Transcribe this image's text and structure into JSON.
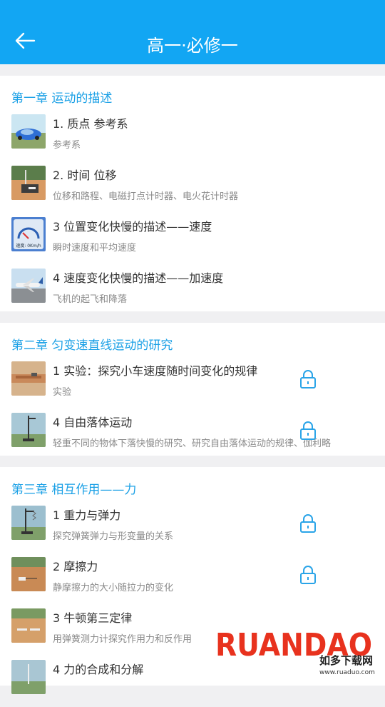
{
  "header": {
    "title": "高一·必修一"
  },
  "colors": {
    "accent": "#12a6f3",
    "chapter": "#1aa0e6"
  },
  "chapters": [
    {
      "title": "第一章 运动的描述",
      "lessons": [
        {
          "title": "1. 质点 参考系",
          "subtitle": "参考系",
          "locked": false,
          "thumb": "race-car-icon"
        },
        {
          "title": "2. 时间 位移",
          "subtitle": "位移和路程、电磁打点计时器、电火花计时器",
          "locked": false,
          "thumb": "timer-apparatus-icon"
        },
        {
          "title": "3 位置变化快慢的描述——速度",
          "subtitle": "瞬时速度和平均速度",
          "locked": false,
          "thumb": "speedometer-icon",
          "thumb_text": "速度: 0Km/h"
        },
        {
          "title": "4 速度变化快慢的描述——加速度",
          "subtitle": "飞机的起飞和降落",
          "locked": false,
          "thumb": "airplane-icon"
        }
      ]
    },
    {
      "title": "第二章 匀变速直线运动的研究",
      "lessons": [
        {
          "title": "1 实验：探究小车速度随时间变化的规律",
          "subtitle": "实验",
          "locked": true,
          "thumb": "cart-track-icon"
        },
        {
          "title": "4 自由落体运动",
          "subtitle": "轻重不同的物体下落快慢的研究、研究自由落体运动的规律、伽利略",
          "locked": true,
          "thumb": "stand-icon"
        }
      ]
    },
    {
      "title": "第三章 相互作用——力",
      "lessons": [
        {
          "title": "1 重力与弹力",
          "subtitle": "探究弹簧弹力与形变量的关系",
          "locked": true,
          "thumb": "spring-stand-icon"
        },
        {
          "title": "2 摩擦力",
          "subtitle": "静摩擦力的大小随拉力的变化",
          "locked": true,
          "thumb": "block-table-icon"
        },
        {
          "title": "3 牛顿第三定律",
          "subtitle": "用弹簧测力计探究作用力和反作用",
          "locked": false,
          "thumb": "spring-scale-icon"
        },
        {
          "title": "4 力的合成和分解",
          "subtitle": "",
          "locked": false,
          "thumb": "force-board-icon"
        }
      ]
    }
  ],
  "watermark": {
    "brand": "RUANDAO",
    "cn": "如多下载网",
    "url": "www.ruaduo.com"
  }
}
